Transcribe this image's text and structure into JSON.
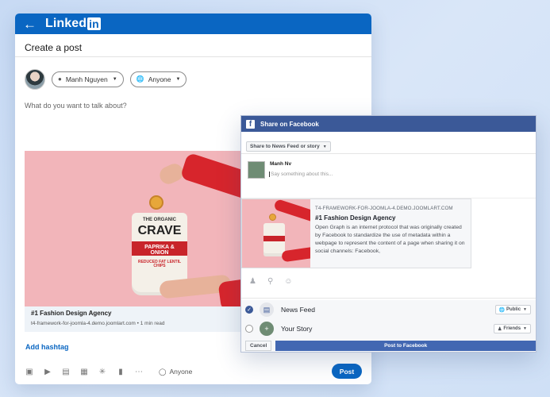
{
  "colors": {
    "linkedin_blue": "#0a66c2",
    "facebook_blue": "#3b5998",
    "photo_pink": "#f2b5ba"
  },
  "linkedin": {
    "logo_text": "Linked",
    "logo_in": "in",
    "header_title": "Create a post",
    "author_name": "Manh Nguyen",
    "audience": "Anyone",
    "placeholder": "What do you want to talk about?",
    "product": {
      "brand": "THE ORGANIC",
      "name": "CRAVE",
      "flavor": "PAPRIKA & ONION",
      "tagline": "REDUCED FAT LENTIL CHIPS"
    },
    "link_title": "#1 Fashion Design Agency",
    "link_subtitle": "t4-framework-for-joomla-4.demo.joomlart.com • 1 min read",
    "add_hashtag": "Add hashtag",
    "toolbar_icons": [
      "image-icon",
      "video-icon",
      "document-icon",
      "article-icon",
      "celebrate-icon",
      "chart-icon",
      "more-icon"
    ],
    "bottom_audience": "Anyone",
    "post_button": "Post"
  },
  "facebook": {
    "title": "Share on Facebook",
    "share_target": "Share to News Feed or story",
    "user_name": "Manh Nv",
    "composer_placeholder": "Say something about this...",
    "share_domain": "T4-FRAMEWORK-FOR-JOOMLA-4.DEMO.JOOMLART.COM",
    "share_title": "#1 Fashion Design Agency",
    "share_description": "Open Graph is an internet protocol that was originally created by Facebook to standardize the use of metadata within a webpage to represent the content of a page when sharing it on social channels: Facebook,",
    "news_feed": {
      "label": "News Feed",
      "checked": true,
      "audience": "Public"
    },
    "your_story": {
      "label": "Your Story",
      "checked": false,
      "audience": "Friends"
    },
    "cancel": "Cancel",
    "post_button": "Post to Facebook"
  }
}
